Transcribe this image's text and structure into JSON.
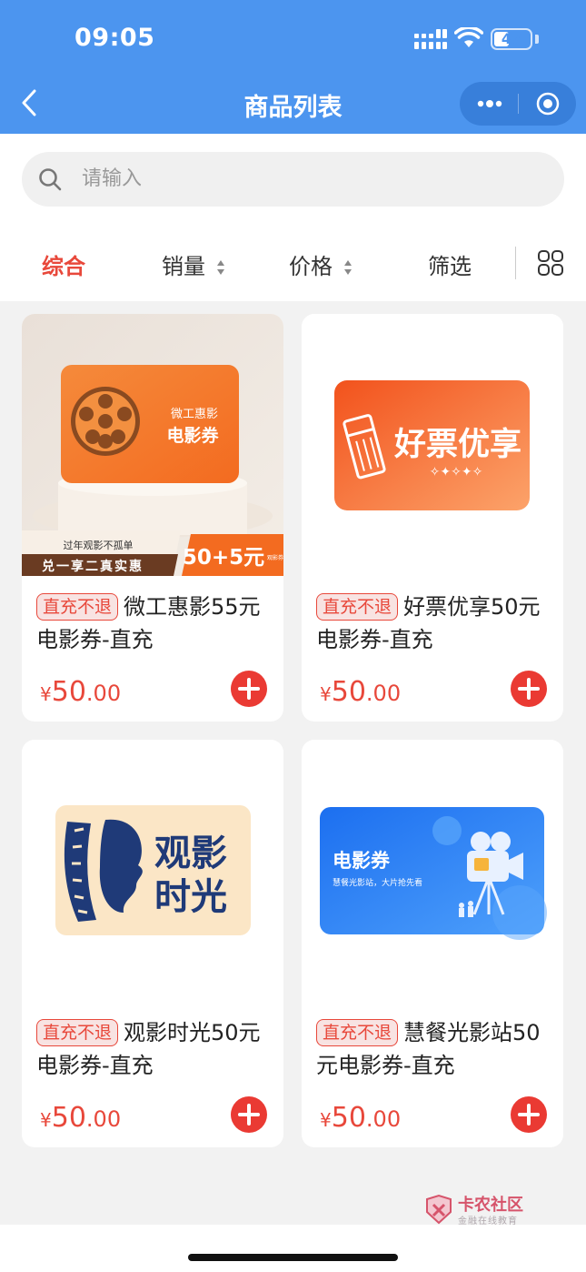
{
  "status_bar": {
    "time": "09:05",
    "battery": "47",
    "battery_level": 0.47
  },
  "nav": {
    "title": "商品列表"
  },
  "search": {
    "placeholder": "请输入"
  },
  "tabs": [
    {
      "label": "综合",
      "active": true
    },
    {
      "label": "销量",
      "sortable": true
    },
    {
      "label": "价格",
      "sortable": true
    },
    {
      "label": "筛选"
    }
  ],
  "products": [
    {
      "tag": "直充不退",
      "title": "微工惠影55元电影券-直充",
      "price_currency": "¥",
      "price_int": "50",
      "price_dec": ".00",
      "image": {
        "brand": "微工惠影",
        "label": "电影券",
        "slogan": "过年观影不孤单",
        "banner": "兑一享二真实惠",
        "promo": "50+5元",
        "promo_note": "观影券"
      }
    },
    {
      "tag": "直充不退",
      "title": "好票优享50元电影券-直充",
      "price_currency": "¥",
      "price_int": "50",
      "price_dec": ".00",
      "image": {
        "label": "好票优享"
      }
    },
    {
      "tag": "直充不退",
      "title": "观影时光50元电影券-直充",
      "price_currency": "¥",
      "price_int": "50",
      "price_dec": ".00",
      "image": {
        "line1": "观影",
        "line2": "时光"
      }
    },
    {
      "tag": "直充不退",
      "title": "慧餐光影站50元电影券-直充",
      "price_currency": "¥",
      "price_int": "50",
      "price_dec": ".00",
      "image": {
        "label": "电影券",
        "sub": "慧餐光影站，大片抢先看"
      }
    }
  ],
  "watermark": {
    "title": "卡农社区",
    "sub": "金融在线教育"
  },
  "colors": {
    "header": "#4c95ef",
    "accent": "#e8483b",
    "background": "#f2f2f2"
  }
}
